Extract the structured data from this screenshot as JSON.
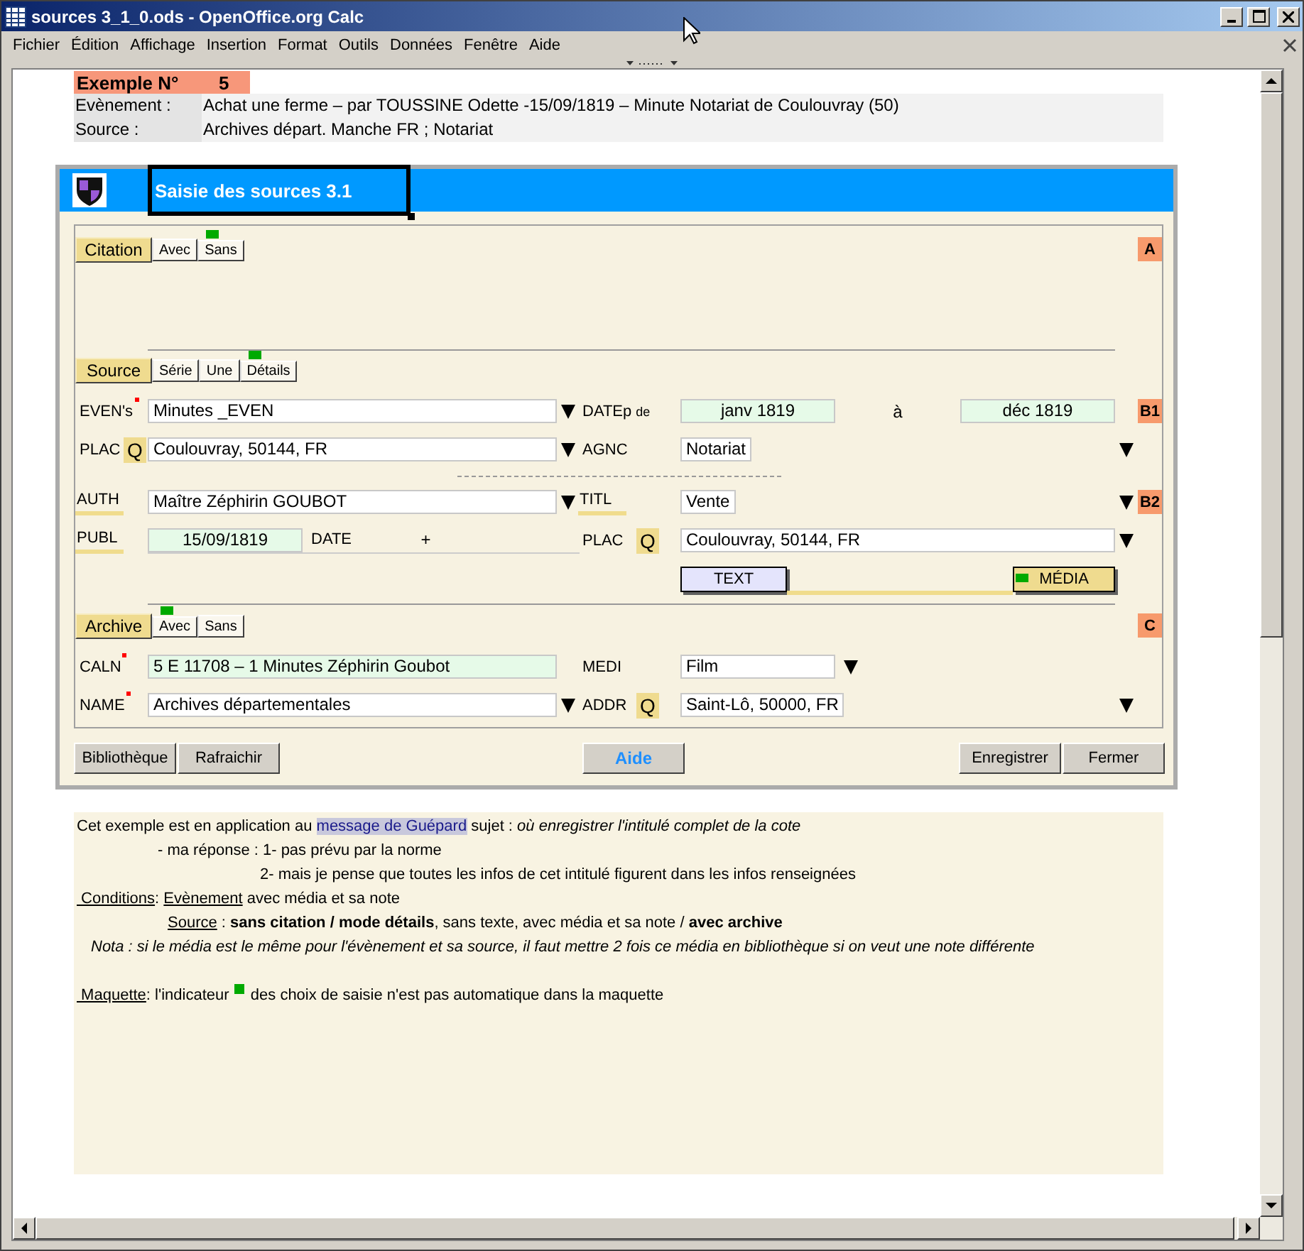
{
  "window": {
    "title": "sources 3_1_0.ods - OpenOffice.org Calc"
  },
  "menu": [
    "Fichier",
    "Édition",
    "Affichage",
    "Insertion",
    "Format",
    "Outils",
    "Données",
    "Fenêtre",
    "Aide"
  ],
  "example": {
    "label": "Exemple N°",
    "number": "5"
  },
  "info": [
    {
      "label": "Evènement :",
      "value": "Achat une ferme – par TOUSSINE Odette -15/09/1819 – Minute Notariat de Coulouvray (50)"
    },
    {
      "label": "Source :",
      "value": "Archives départ. Manche FR ; Notariat"
    }
  ],
  "form": {
    "title": "Saisie des sources 3.1",
    "sections": [
      {
        "label": "Citation",
        "badge": "A",
        "options": [
          {
            "label": "Avec",
            "selected": false
          },
          {
            "label": "Sans",
            "selected": true
          }
        ]
      },
      {
        "label": "Source",
        "options": [
          {
            "label": "Série",
            "selected": false
          },
          {
            "label": "Une",
            "selected": false
          },
          {
            "label": "Détails",
            "selected": true
          }
        ],
        "rows": [
          {
            "kind": "dates",
            "badge": "B1",
            "left": {
              "label": "EVEN's",
              "required": true,
              "kind": "entry",
              "value": "Minutes _EVEN",
              "dropdown": true
            },
            "right": {
              "label": "DATEp",
              "sublabel": "de",
              "from": "janv 1819",
              "sep": "à",
              "to": "déc 1819"
            }
          },
          {
            "kind": "pair",
            "left": {
              "label": "PLAC",
              "lookup": "Q",
              "kind": "entry",
              "value": "Coulouvray, 50144, FR",
              "dropdown": true
            },
            "right": {
              "label": "AGNC",
              "kind": "entry",
              "value": "Notariat",
              "dropdown": true
            }
          },
          {
            "kind": "separator"
          },
          {
            "kind": "pair",
            "badge": "B2",
            "left": {
              "label": "AUTH",
              "underline": true,
              "kind": "entry",
              "value": "Maître Zéphirin GOUBOT",
              "dropdown": true
            },
            "right": {
              "label": "TITL",
              "underline": true,
              "kind": "entry",
              "value": "Vente",
              "dropdown": true
            }
          },
          {
            "kind": "publ",
            "left": {
              "label": "PUBL",
              "underline": true,
              "kind": "computed",
              "value": "15/09/1819"
            },
            "middle": {
              "label": "DATE",
              "plus": "+"
            },
            "right": {
              "label": "PLAC",
              "lookup": "Q",
              "kind": "entry",
              "value": "Coulouvray, 50144, FR",
              "dropdown": true
            }
          },
          {
            "kind": "attachments",
            "options": [
              {
                "label": "TEXT",
                "selected": false
              },
              {
                "label": "MÉDIA",
                "selected": true
              }
            ]
          }
        ]
      },
      {
        "label": "Archive",
        "badge": "C",
        "options": [
          {
            "label": "Avec",
            "selected": true
          },
          {
            "label": "Sans",
            "selected": false
          }
        ],
        "rows": [
          {
            "kind": "pair",
            "left": {
              "label": "CALN",
              "required": true,
              "kind": "computed",
              "value": "5 E 11708 – 1 Minutes Zéphirin Goubot"
            },
            "right": {
              "label": "MEDI",
              "kind": "compact",
              "value": "Film",
              "dropdown": true
            }
          },
          {
            "kind": "pair",
            "left": {
              "label": "NAME",
              "required": true,
              "kind": "entry",
              "value": "Archives départementales",
              "dropdown": true
            },
            "right": {
              "label": "ADDR",
              "lookup": "Q",
              "kind": "entry",
              "value": "Saint-Lô, 50000, FR",
              "dropdown": true
            }
          }
        ]
      }
    ],
    "buttons": [
      {
        "label": "Bibliothèque",
        "kind": "left"
      },
      {
        "label": "Rafraichir",
        "kind": "left"
      },
      {
        "label": "Aide",
        "kind": "help"
      },
      {
        "label": "Enregistrer",
        "kind": "right"
      },
      {
        "label": "Fermer",
        "kind": "right"
      }
    ]
  },
  "notes": [
    {
      "kind": "plain",
      "segments": [
        {
          "kind": "text",
          "text": "Cet exemple est en application au "
        },
        {
          "kind": "link",
          "text": "message de Guépard"
        },
        {
          "kind": "text",
          "text": " sujet : *où enregistrer l'intitulé complet de la cote*"
        }
      ]
    },
    {
      "kind": "reply",
      "segments": [
        {
          "kind": "text",
          "text": "- ma réponse : 1- pas prévu par la norme"
        }
      ]
    },
    {
      "kind": "reply-more",
      "segments": [
        {
          "kind": "text",
          "text": "2- mais je pense que toutes les infos de cet intitulé figurent dans les infos renseignées"
        }
      ]
    },
    {
      "kind": "plain",
      "segments": [
        {
          "kind": "underlined",
          "text": " Conditions"
        },
        {
          "kind": "text",
          "text": ": "
        },
        {
          "kind": "underlined",
          "text": "Evènement"
        },
        {
          "kind": "text",
          "text": " avec média et sa note"
        }
      ]
    },
    {
      "kind": "detail",
      "segments": [
        {
          "kind": "underlined",
          "text": "Source"
        },
        {
          "kind": "text",
          "text": " : **sans citation / mode détails**, sans texte, avec média et sa note / **avec archive**"
        }
      ]
    },
    {
      "kind": "nota",
      "segments": [
        {
          "kind": "text",
          "text": "Nota : si le média est le même pour l'évènement et sa source, il faut mettre 2 fois ce média en bibliothèque si on veut une note différente"
        }
      ]
    },
    {
      "kind": "spaced",
      "segments": [
        {
          "kind": "underlined",
          "text": " Maquette"
        },
        {
          "kind": "text",
          "text": ": l'indicateur "
        },
        {
          "kind": "indicator"
        },
        {
          "kind": "text",
          "text": " des choix de saisie n'est pas automatique dans la maquette"
        }
      ]
    }
  ]
}
